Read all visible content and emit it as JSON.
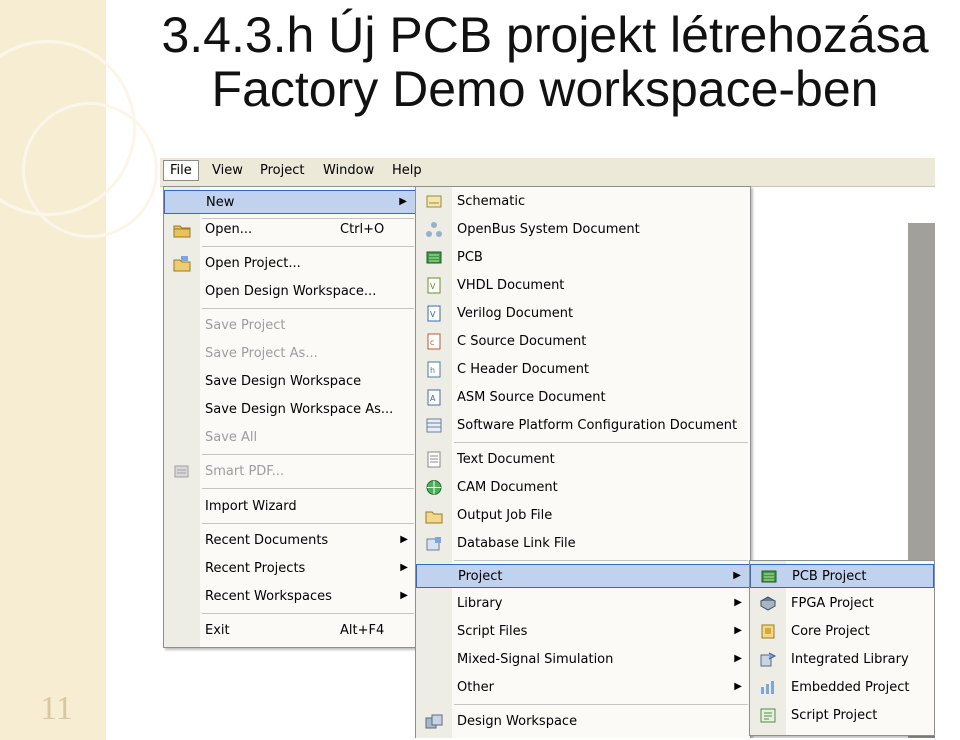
{
  "slide": {
    "title_line1": "3.4.3.h Új PCB projekt létrehozása",
    "title_line2": "Factory Demo workspace-ben",
    "page_number": "11"
  },
  "menubar": {
    "items": [
      "File",
      "View",
      "Project",
      "Window",
      "Help"
    ]
  },
  "file_menu": {
    "items": [
      {
        "label": "New",
        "submenu": true,
        "highlighted": true
      },
      {
        "label": "Open...",
        "shortcut": "Ctrl+O",
        "icon": "open-folder-icon"
      },
      {
        "label": "Open Project...",
        "icon": "open-project-icon"
      },
      {
        "label": "Open Design Workspace..."
      },
      {
        "label": "Save Project",
        "disabled": true
      },
      {
        "label": "Save Project As...",
        "disabled": true
      },
      {
        "label": "Save Design Workspace"
      },
      {
        "label": "Save Design Workspace As..."
      },
      {
        "label": "Save All",
        "disabled": true
      },
      {
        "label": "Smart PDF...",
        "disabled": true,
        "icon": "smart-pdf-icon"
      },
      {
        "label": "Import Wizard"
      },
      {
        "label": "Recent Documents",
        "submenu": true
      },
      {
        "label": "Recent Projects",
        "submenu": true
      },
      {
        "label": "Recent Workspaces",
        "submenu": true
      },
      {
        "label": "Exit",
        "shortcut": "Alt+F4"
      }
    ]
  },
  "new_menu": {
    "items": [
      {
        "label": "Schematic",
        "icon": "schematic-icon"
      },
      {
        "label": "OpenBus System Document",
        "icon": "openbus-icon"
      },
      {
        "label": "PCB",
        "icon": "pcb-icon"
      },
      {
        "label": "VHDL Document",
        "icon": "vhdl-icon"
      },
      {
        "label": "Verilog Document",
        "icon": "verilog-icon"
      },
      {
        "label": "C Source Document",
        "icon": "c-source-icon"
      },
      {
        "label": "C Header Document",
        "icon": "c-header-icon"
      },
      {
        "label": "ASM Source Document",
        "icon": "asm-icon"
      },
      {
        "label": "Software Platform Configuration Document",
        "icon": "software-platform-icon"
      },
      {
        "label": "Text Document",
        "icon": "text-document-icon"
      },
      {
        "label": "CAM Document",
        "icon": "cam-icon"
      },
      {
        "label": "Output Job File",
        "icon": "output-job-icon"
      },
      {
        "label": "Database Link File",
        "icon": "database-link-icon"
      },
      {
        "label": "Project",
        "submenu": true,
        "highlighted": true
      },
      {
        "label": "Library",
        "submenu": true
      },
      {
        "label": "Script Files",
        "submenu": true
      },
      {
        "label": "Mixed-Signal Simulation",
        "submenu": true
      },
      {
        "label": "Other",
        "submenu": true
      },
      {
        "label": "Design Workspace",
        "icon": "design-workspace-icon"
      }
    ]
  },
  "project_menu": {
    "items": [
      {
        "label": "PCB Project",
        "icon": "pcb-project-icon",
        "highlighted": true
      },
      {
        "label": "FPGA Project",
        "icon": "fpga-project-icon"
      },
      {
        "label": "Core Project",
        "icon": "core-project-icon"
      },
      {
        "label": "Integrated Library",
        "icon": "integrated-library-icon"
      },
      {
        "label": "Embedded Project",
        "icon": "embedded-project-icon"
      },
      {
        "label": "Script Project",
        "icon": "script-project-icon"
      }
    ]
  },
  "colors": {
    "highlight": "#c1d2ee",
    "highlight_border": "#316ac5",
    "menubar": "#ece9d8",
    "disabled_text": "#9d9d9d",
    "slide_decor": "#f6edd3"
  }
}
